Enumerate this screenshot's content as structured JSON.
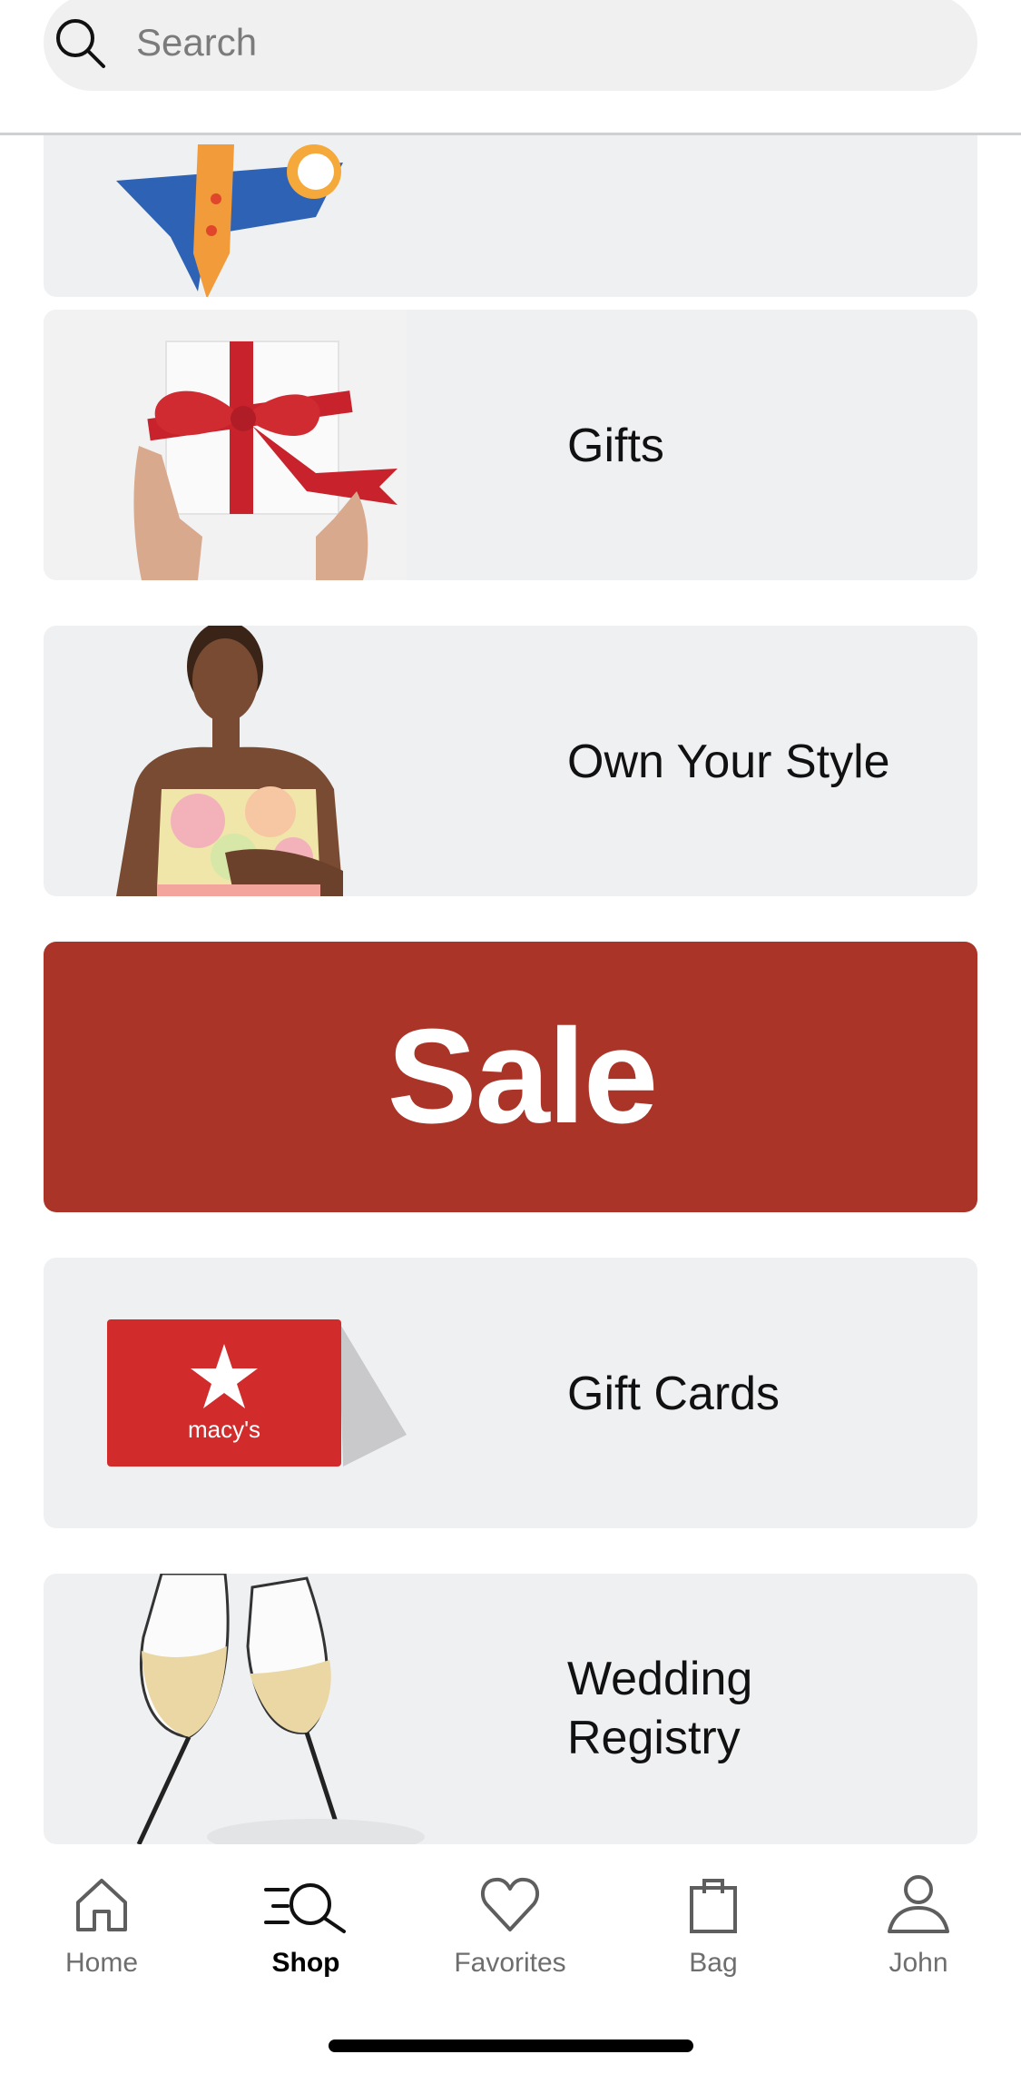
{
  "search": {
    "placeholder": "Search"
  },
  "cards": [
    {
      "label": ""
    },
    {
      "label": "Gifts"
    },
    {
      "label": "Own Your Style"
    },
    {
      "label": "Sale"
    },
    {
      "label": "Gift Cards",
      "logo_text": "macy's"
    },
    {
      "label": "Wedding Registry",
      "line1": "Wedding",
      "line2": "Registry"
    }
  ],
  "tabs": [
    {
      "label": "Home",
      "icon": "home-icon"
    },
    {
      "label": "Shop",
      "icon": "shop-search-icon",
      "active": true
    },
    {
      "label": "Favorites",
      "icon": "heart-icon"
    },
    {
      "label": "Bag",
      "icon": "bag-icon"
    },
    {
      "label": "John",
      "icon": "person-icon"
    }
  ],
  "colors": {
    "sale": "#ab3428",
    "card_bg": "#eff0f2",
    "search_bg": "#f0f0f0"
  }
}
